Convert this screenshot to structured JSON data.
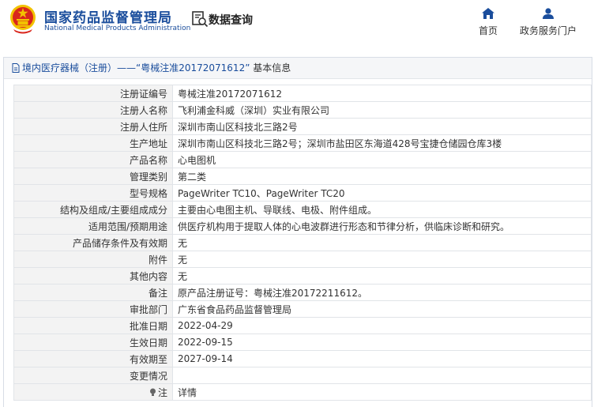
{
  "header": {
    "org_name_cn": "国家药品监督管理局",
    "org_name_en": "National Medical Products Administration",
    "page_title": "数据查询",
    "nav": [
      {
        "label": "首页",
        "icon": "home-icon"
      },
      {
        "label": "政务服务门户",
        "icon": "user-icon"
      }
    ]
  },
  "panel": {
    "title": "境内医疗器械（注册）——“粤械注准20172071612”",
    "title_suffix": "基本信息"
  },
  "rows": [
    {
      "label": "注册证编号",
      "value": "粤械注准20172071612"
    },
    {
      "label": "注册人名称",
      "value": "飞利浦金科威（深圳）实业有限公司"
    },
    {
      "label": "注册人住所",
      "value": "深圳市南山区科技北三路2号"
    },
    {
      "label": "生产地址",
      "value": "深圳市南山区科技北三路2号；深圳市盐田区东海道428号宝捷仓储园仓库3楼"
    },
    {
      "label": "产品名称",
      "value": "心电图机"
    },
    {
      "label": "管理类别",
      "value": "第二类"
    },
    {
      "label": "型号规格",
      "value": "PageWriter TC10、PageWriter TC20"
    },
    {
      "label": "结构及组成/主要组成成分",
      "value": "主要由心电图主机、导联线、电极、附件组成。"
    },
    {
      "label": "适用范围/预期用途",
      "value": "供医疗机构用于提取人体的心电波群进行形态和节律分析，供临床诊断和研究。"
    },
    {
      "label": "产品储存条件及有效期",
      "value": "无"
    },
    {
      "label": "附件",
      "value": "无"
    },
    {
      "label": "其他内容",
      "value": "无"
    },
    {
      "label": "备注",
      "value": "原产品注册证号：粤械注准20172211612。"
    },
    {
      "label": "审批部门",
      "value": "广东省食品药品监督管理局"
    },
    {
      "label": "批准日期",
      "value": "2022-04-29"
    },
    {
      "label": "生效日期",
      "value": "2022-09-15"
    },
    {
      "label": "有效期至",
      "value": "2027-09-14"
    },
    {
      "label": "变更情况",
      "value": ""
    },
    {
      "label": "注",
      "value": "详情"
    }
  ],
  "colors": {
    "brand_blue": "#1a4d9c",
    "link_blue": "#2a6fd6",
    "emblem_red": "#d9261c",
    "emblem_gold": "#f2c200"
  }
}
